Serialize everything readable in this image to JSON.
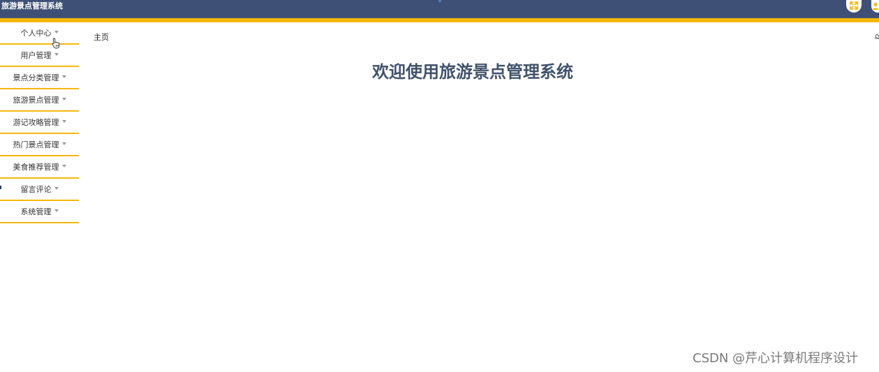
{
  "header": {
    "app_title": "旅游景点管理系统",
    "fullscreen_icon": "fullscreen-icon",
    "avatar_icon": "user-avatar-icon",
    "colors": {
      "bar": "#3f5076",
      "accent": "#f7b70d"
    }
  },
  "sidebar": {
    "items": [
      {
        "label": "个人中心"
      },
      {
        "label": "用户管理"
      },
      {
        "label": "景点分类管理"
      },
      {
        "label": "旅游景点管理"
      },
      {
        "label": "游记攻略管理"
      },
      {
        "label": "热门景点管理"
      },
      {
        "label": "美食推荐管理"
      },
      {
        "label": "留言评论"
      },
      {
        "label": "系统管理"
      }
    ],
    "caret_icon": "caret-down-icon"
  },
  "main": {
    "breadcrumb": "主页",
    "welcome_title": "欢迎使用旅游景点管理系统"
  },
  "watermark": {
    "text": "CSDN @芹心计算机程序设计"
  }
}
